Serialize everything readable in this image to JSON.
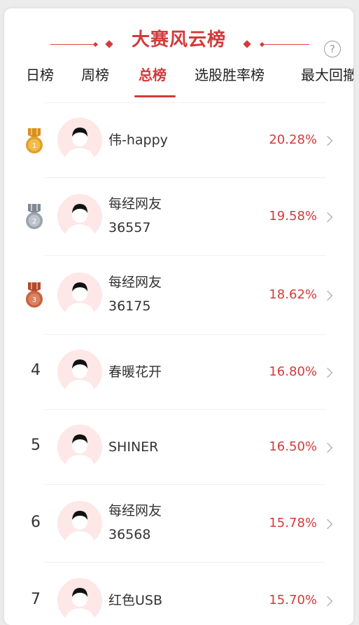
{
  "header": {
    "title": "大赛风云榜",
    "help_icon": "?"
  },
  "tabs": [
    {
      "label": "日榜",
      "active": false
    },
    {
      "label": "周榜",
      "active": false
    },
    {
      "label": "总榜",
      "active": true
    },
    {
      "label": "选股胜率榜",
      "active": false
    },
    {
      "label": "最大回撤",
      "active": false
    }
  ],
  "leaderboard": [
    {
      "rank": "1",
      "medal": "gold",
      "name_line1": "伟-happy",
      "name_line2": "",
      "percent": "20.28%"
    },
    {
      "rank": "2",
      "medal": "silver",
      "name_line1": "每经网友",
      "name_line2": "36557",
      "percent": "19.58%"
    },
    {
      "rank": "3",
      "medal": "bronze",
      "name_line1": "每经网友",
      "name_line2": "36175",
      "percent": "18.62%"
    },
    {
      "rank": "4",
      "medal": "",
      "name_line1": "春暖花开",
      "name_line2": "",
      "percent": "16.80%"
    },
    {
      "rank": "5",
      "medal": "",
      "name_line1": "SHINER",
      "name_line2": "",
      "percent": "16.50%"
    },
    {
      "rank": "6",
      "medal": "",
      "name_line1": "每经网友",
      "name_line2": "36568",
      "percent": "15.78%"
    },
    {
      "rank": "7",
      "medal": "",
      "name_line1": "红色USB",
      "name_line2": "",
      "percent": "15.70%"
    }
  ],
  "colors": {
    "accent": "#d43a3a",
    "gold": "#e0a12a",
    "silver": "#9aa3ad",
    "bronze": "#c9623f",
    "avatar_bg": "#fde7e7"
  }
}
